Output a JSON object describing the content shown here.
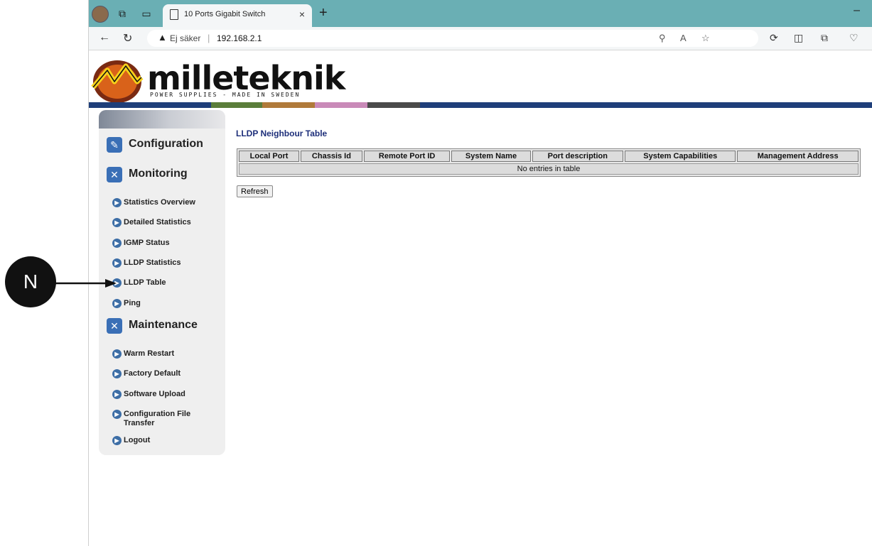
{
  "browser": {
    "tab_title": "10 Ports Gigabit Switch",
    "tab_close": "×",
    "new_tab": "+",
    "minimize": "–",
    "security_label": "Ej säker",
    "url": "192.168.2.1",
    "accent_color": "#6aafb4"
  },
  "header": {
    "logo_text": "milleteknik",
    "logo_tagline": "POWER SUPPLIES - MADE IN SWEDEN"
  },
  "sidebar": {
    "sections": [
      {
        "label": "Configuration",
        "icon": "configuration-icon"
      },
      {
        "label": "Monitoring",
        "icon": "tools-icon"
      },
      {
        "label": "Maintenance",
        "icon": "tools-icon"
      }
    ],
    "monitoring_items": [
      {
        "label": "Statistics Overview"
      },
      {
        "label": "Detailed Statistics"
      },
      {
        "label": "IGMP Status"
      },
      {
        "label": "LLDP Statistics"
      },
      {
        "label": "LLDP Table"
      },
      {
        "label": "Ping"
      }
    ],
    "maintenance_items": [
      {
        "label": "Warm Restart"
      },
      {
        "label": "Factory Default"
      },
      {
        "label": "Software Upload"
      },
      {
        "label": "Configuration File Transfer"
      },
      {
        "label": "Logout"
      }
    ]
  },
  "main": {
    "title": "LLDP Neighbour Table",
    "columns": [
      "Local Port",
      "Chassis Id",
      "Remote Port ID",
      "System Name",
      "Port description",
      "System Capabilities",
      "Management Address"
    ],
    "empty_message": "No entries in table",
    "refresh_label": "Refresh"
  },
  "annotation": {
    "label": "N",
    "target": "LLDP Table"
  }
}
